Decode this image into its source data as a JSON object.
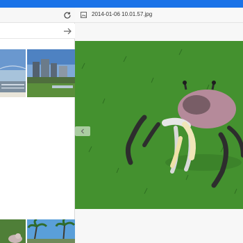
{
  "app": {
    "accent_color": "#1a73e8"
  },
  "left": {
    "refresh_icon": "refresh-icon",
    "arrow_icon": "arrow-right-icon",
    "thumbnails_top": [
      {
        "name": "thumb-bridge-city"
      },
      {
        "name": "thumb-city-park"
      }
    ],
    "thumbnails_bottom": [
      {
        "name": "thumb-person-crab"
      },
      {
        "name": "thumb-palm-trees"
      }
    ]
  },
  "viewer": {
    "file_title": "2014-01-06 10.01.57.jpg",
    "file_icon": "image-file-icon",
    "prev_icon": "chevron-left-icon"
  }
}
